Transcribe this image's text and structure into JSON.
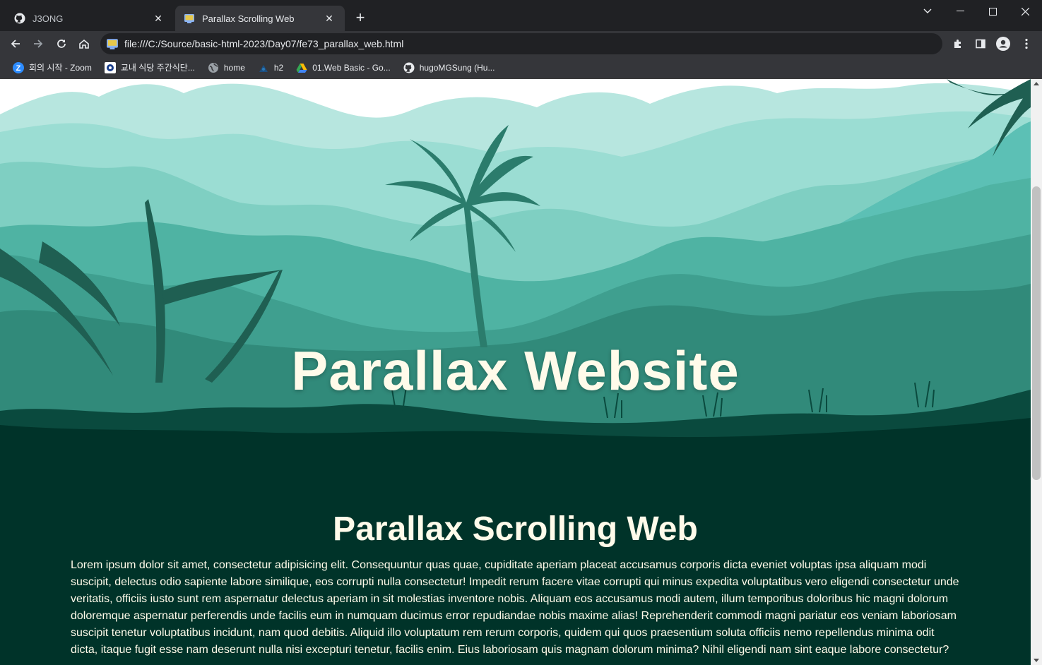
{
  "tabs": [
    {
      "title": "J3ONG",
      "icon": "github-icon",
      "active": false
    },
    {
      "title": "Parallax Scrolling Web",
      "icon": "html-file-icon",
      "active": true
    }
  ],
  "toolbar": {
    "url": "file:///C:/Source/basic-html-2023/Day07/fe73_parallax_web.html"
  },
  "bookmarks": [
    {
      "label": "회의 시작 - Zoom",
      "icon": "zoom-icon"
    },
    {
      "label": "교내 식당 주간식단...",
      "icon": "school-icon"
    },
    {
      "label": "home",
      "icon": "globe-icon"
    },
    {
      "label": "h2",
      "icon": "h2-icon"
    },
    {
      "label": "01.Web Basic - Go...",
      "icon": "google-drive-icon"
    },
    {
      "label": "hugoMGSung (Hu...",
      "icon": "github-icon"
    }
  ],
  "page": {
    "hero_title": "Parallax Website",
    "section_title": "Parallax Scrolling Web",
    "paragraph": "Lorem ipsum dolor sit amet, consectetur adipisicing elit. Consequuntur quas quae, cupiditate aperiam placeat accusamus corporis dicta eveniet voluptas ipsa aliquam modi suscipit, delectus odio sapiente labore similique, eos corrupti nulla consectetur! Impedit rerum facere vitae corrupti qui minus expedita voluptatibus vero eligendi consectetur unde veritatis, officiis iusto sunt rem aspernatur delectus aperiam in sit molestias inventore nobis. Aliquam eos accusamus modi autem, illum temporibus doloribus hic magni dolorum doloremque aspernatur perferendis unde facilis eum in numquam ducimus error repudiandae nobis maxime alias! Reprehenderit commodi magni pariatur eos veniam laboriosam suscipit tenetur voluptatibus incidunt, nam quod debitis. Aliquid illo voluptatum rem rerum corporis, quidem qui quos praesentium soluta officiis nemo repellendus minima odit dicta, itaque fugit esse nam deserunt nulla nisi excepturi tenetur, facilis enim. Eius laboriosam quis magnam dolorum minima? Nihil eligendi nam sint eaque labore consectetur?"
  },
  "colors": {
    "sky": "#ffffff",
    "mountain_far": "#b7e6df",
    "mountain_mid": "#7fcfc2",
    "mountain_near": "#4fb3a3",
    "jungle": "#2b7c6c",
    "ground": "#003329",
    "title_text": "#fffbea"
  }
}
